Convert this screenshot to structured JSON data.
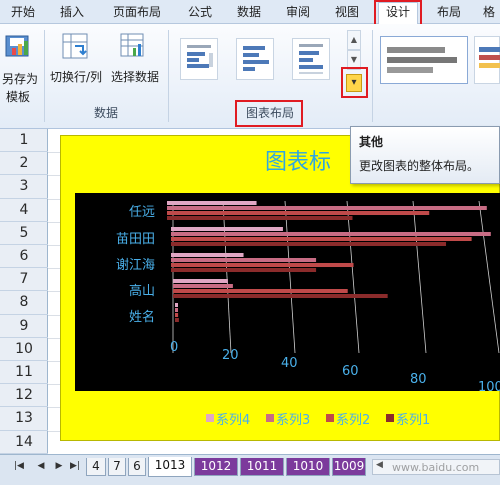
{
  "ribbon_tabs": [
    "开始",
    "插入",
    "页面布局",
    "公式",
    "数据",
    "审阅",
    "视图",
    "设计",
    "布局",
    "格"
  ],
  "ribbon": {
    "save_as_template_label_1": "另存为",
    "save_as_template_label_2": "模板",
    "switch_row_col": "切换行/列",
    "select_data": "选择数据",
    "data_group": "数据",
    "chart_layout_group": "图表布局",
    "more_arrow": "▾"
  },
  "tooltip": {
    "title": "其他",
    "body": "更改图表的整体布局。"
  },
  "row_headers": [
    "1",
    "2",
    "3",
    "4",
    "5",
    "6",
    "7",
    "8",
    "9",
    "10",
    "11",
    "12",
    "13",
    "14"
  ],
  "sheet_tabs": [
    "4",
    "7",
    "6",
    "1013",
    "1012",
    "1011",
    "1010",
    "1009"
  ],
  "active_sheet": "1013",
  "nav_glyphs": [
    "|◀",
    "◀",
    "▶",
    "▶|"
  ],
  "watermark": "www.baidu.com",
  "chart_data": {
    "type": "bar",
    "title": "图表标",
    "categories": [
      "任远",
      "苗田田",
      "谢江海",
      "高山",
      "姓名"
    ],
    "x_ticks": [
      "0",
      "20",
      "40",
      "60",
      "80",
      "100"
    ],
    "xlim": [
      0,
      100
    ],
    "series": [
      {
        "name": "系列4",
        "color": "#e0a7c4",
        "values": [
          28,
          35,
          31,
          22,
          2
        ]
      },
      {
        "name": "系列3",
        "color": "#c86c84",
        "values": [
          100,
          100,
          62,
          24,
          3
        ]
      },
      {
        "name": "系列2",
        "color": "#c04a4a",
        "values": [
          82,
          94,
          78,
          70,
          4
        ]
      },
      {
        "name": "系列1",
        "color": "#8b2b2b",
        "values": [
          58,
          86,
          62,
          86,
          5
        ]
      }
    ],
    "legend_position": "bottom",
    "background": "#ffff00",
    "plot_background": "#000000",
    "label_color": "#4ab0ea"
  }
}
